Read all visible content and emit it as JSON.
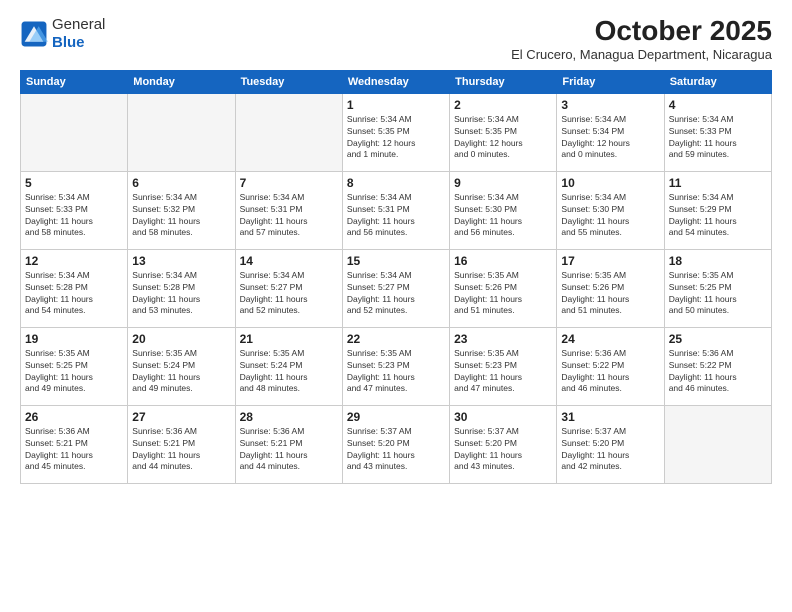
{
  "header": {
    "logo_general": "General",
    "logo_blue": "Blue",
    "month_title": "October 2025",
    "location": "El Crucero, Managua Department, Nicaragua"
  },
  "days_of_week": [
    "Sunday",
    "Monday",
    "Tuesday",
    "Wednesday",
    "Thursday",
    "Friday",
    "Saturday"
  ],
  "weeks": [
    [
      {
        "day": "",
        "info": ""
      },
      {
        "day": "",
        "info": ""
      },
      {
        "day": "",
        "info": ""
      },
      {
        "day": "1",
        "info": "Sunrise: 5:34 AM\nSunset: 5:35 PM\nDaylight: 12 hours\nand 1 minute."
      },
      {
        "day": "2",
        "info": "Sunrise: 5:34 AM\nSunset: 5:35 PM\nDaylight: 12 hours\nand 0 minutes."
      },
      {
        "day": "3",
        "info": "Sunrise: 5:34 AM\nSunset: 5:34 PM\nDaylight: 12 hours\nand 0 minutes."
      },
      {
        "day": "4",
        "info": "Sunrise: 5:34 AM\nSunset: 5:33 PM\nDaylight: 11 hours\nand 59 minutes."
      }
    ],
    [
      {
        "day": "5",
        "info": "Sunrise: 5:34 AM\nSunset: 5:33 PM\nDaylight: 11 hours\nand 58 minutes."
      },
      {
        "day": "6",
        "info": "Sunrise: 5:34 AM\nSunset: 5:32 PM\nDaylight: 11 hours\nand 58 minutes."
      },
      {
        "day": "7",
        "info": "Sunrise: 5:34 AM\nSunset: 5:31 PM\nDaylight: 11 hours\nand 57 minutes."
      },
      {
        "day": "8",
        "info": "Sunrise: 5:34 AM\nSunset: 5:31 PM\nDaylight: 11 hours\nand 56 minutes."
      },
      {
        "day": "9",
        "info": "Sunrise: 5:34 AM\nSunset: 5:30 PM\nDaylight: 11 hours\nand 56 minutes."
      },
      {
        "day": "10",
        "info": "Sunrise: 5:34 AM\nSunset: 5:30 PM\nDaylight: 11 hours\nand 55 minutes."
      },
      {
        "day": "11",
        "info": "Sunrise: 5:34 AM\nSunset: 5:29 PM\nDaylight: 11 hours\nand 54 minutes."
      }
    ],
    [
      {
        "day": "12",
        "info": "Sunrise: 5:34 AM\nSunset: 5:28 PM\nDaylight: 11 hours\nand 54 minutes."
      },
      {
        "day": "13",
        "info": "Sunrise: 5:34 AM\nSunset: 5:28 PM\nDaylight: 11 hours\nand 53 minutes."
      },
      {
        "day": "14",
        "info": "Sunrise: 5:34 AM\nSunset: 5:27 PM\nDaylight: 11 hours\nand 52 minutes."
      },
      {
        "day": "15",
        "info": "Sunrise: 5:34 AM\nSunset: 5:27 PM\nDaylight: 11 hours\nand 52 minutes."
      },
      {
        "day": "16",
        "info": "Sunrise: 5:35 AM\nSunset: 5:26 PM\nDaylight: 11 hours\nand 51 minutes."
      },
      {
        "day": "17",
        "info": "Sunrise: 5:35 AM\nSunset: 5:26 PM\nDaylight: 11 hours\nand 51 minutes."
      },
      {
        "day": "18",
        "info": "Sunrise: 5:35 AM\nSunset: 5:25 PM\nDaylight: 11 hours\nand 50 minutes."
      }
    ],
    [
      {
        "day": "19",
        "info": "Sunrise: 5:35 AM\nSunset: 5:25 PM\nDaylight: 11 hours\nand 49 minutes."
      },
      {
        "day": "20",
        "info": "Sunrise: 5:35 AM\nSunset: 5:24 PM\nDaylight: 11 hours\nand 49 minutes."
      },
      {
        "day": "21",
        "info": "Sunrise: 5:35 AM\nSunset: 5:24 PM\nDaylight: 11 hours\nand 48 minutes."
      },
      {
        "day": "22",
        "info": "Sunrise: 5:35 AM\nSunset: 5:23 PM\nDaylight: 11 hours\nand 47 minutes."
      },
      {
        "day": "23",
        "info": "Sunrise: 5:35 AM\nSunset: 5:23 PM\nDaylight: 11 hours\nand 47 minutes."
      },
      {
        "day": "24",
        "info": "Sunrise: 5:36 AM\nSunset: 5:22 PM\nDaylight: 11 hours\nand 46 minutes."
      },
      {
        "day": "25",
        "info": "Sunrise: 5:36 AM\nSunset: 5:22 PM\nDaylight: 11 hours\nand 46 minutes."
      }
    ],
    [
      {
        "day": "26",
        "info": "Sunrise: 5:36 AM\nSunset: 5:21 PM\nDaylight: 11 hours\nand 45 minutes."
      },
      {
        "day": "27",
        "info": "Sunrise: 5:36 AM\nSunset: 5:21 PM\nDaylight: 11 hours\nand 44 minutes."
      },
      {
        "day": "28",
        "info": "Sunrise: 5:36 AM\nSunset: 5:21 PM\nDaylight: 11 hours\nand 44 minutes."
      },
      {
        "day": "29",
        "info": "Sunrise: 5:37 AM\nSunset: 5:20 PM\nDaylight: 11 hours\nand 43 minutes."
      },
      {
        "day": "30",
        "info": "Sunrise: 5:37 AM\nSunset: 5:20 PM\nDaylight: 11 hours\nand 43 minutes."
      },
      {
        "day": "31",
        "info": "Sunrise: 5:37 AM\nSunset: 5:20 PM\nDaylight: 11 hours\nand 42 minutes."
      },
      {
        "day": "",
        "info": ""
      }
    ]
  ]
}
